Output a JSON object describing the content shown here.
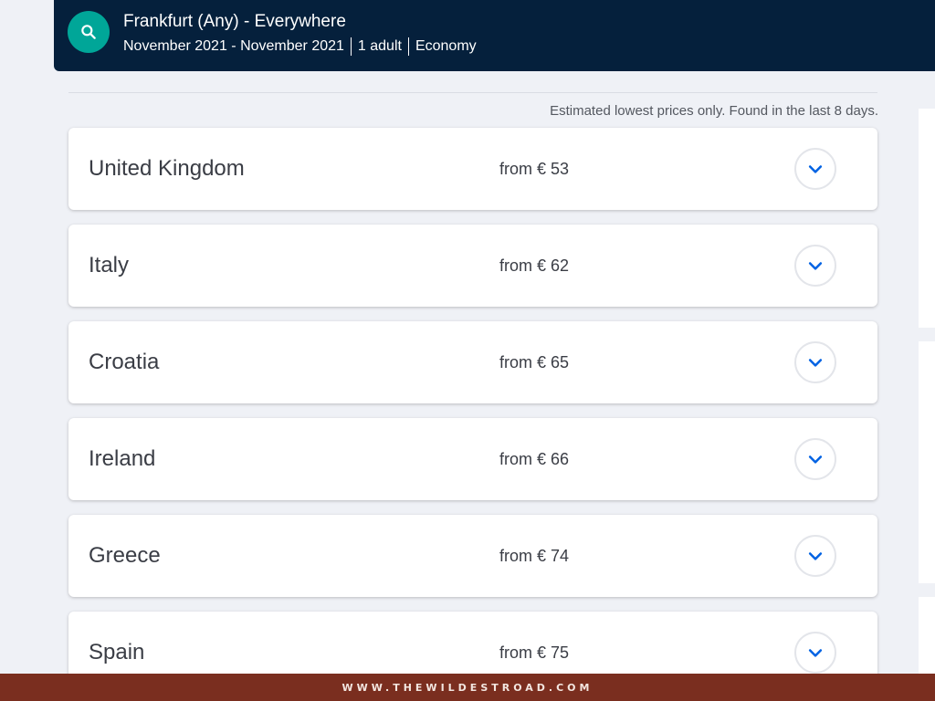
{
  "search": {
    "route": "Frankfurt (Any) - Everywhere",
    "dates": "November 2021 - November 2021",
    "travellers": "1 adult",
    "cabin_class": "Economy",
    "button_icon": "search-icon"
  },
  "disclaimer": "Estimated lowest prices only. Found in the last 8 days.",
  "results": [
    {
      "country": "United Kingdom",
      "price": "from € 53"
    },
    {
      "country": "Italy",
      "price": "from € 62"
    },
    {
      "country": "Croatia",
      "price": "from € 65"
    },
    {
      "country": "Ireland",
      "price": "from € 66"
    },
    {
      "country": "Greece",
      "price": "from € 74"
    },
    {
      "country": "Spain",
      "price": "from € 75"
    }
  ],
  "expand_icon": "chevron-down-icon",
  "footer": {
    "watermark": "WWW.THEWILDESTROAD.COM"
  },
  "colors": {
    "header_bg": "#05203c",
    "search_button": "#00a698",
    "chevron": "#0062e3",
    "page_bg": "#eff1f6",
    "footer_bg": "#7a2e1f"
  }
}
